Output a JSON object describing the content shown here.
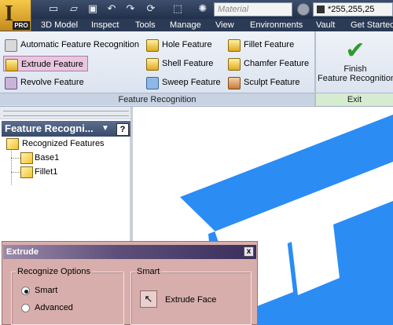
{
  "app": {
    "badge": "PRO"
  },
  "quick_access": {
    "icons": [
      "new-icon",
      "open-icon",
      "save-icon",
      "undo-icon",
      "redo-icon",
      "update-icon",
      "select-icon",
      "appearance-icon"
    ],
    "material_placeholder": "Material",
    "color_value": "*255,255,25"
  },
  "tabs": [
    "3D Model",
    "Inspect",
    "Tools",
    "Manage",
    "View",
    "Environments",
    "Vault",
    "Get Started"
  ],
  "active_tab": "",
  "ribbon": {
    "buttons": [
      {
        "label": "Automatic Feature Recognition",
        "icon": "auto-recognition-icon"
      },
      {
        "label": "Extrude Feature",
        "icon": "extrude-icon"
      },
      {
        "label": "Revolve Feature",
        "icon": "revolve-icon"
      },
      {
        "label": "Hole Feature",
        "icon": "hole-icon"
      },
      {
        "label": "Shell Feature",
        "icon": "shell-icon"
      },
      {
        "label": "Sweep Feature",
        "icon": "sweep-icon"
      },
      {
        "label": "Fillet Feature",
        "icon": "fillet-icon"
      },
      {
        "label": "Chamfer Feature",
        "icon": "chamfer-icon"
      },
      {
        "label": "Sculpt Feature",
        "icon": "sculpt-icon"
      }
    ],
    "panel_label": "Feature Recognition",
    "finish_line1": "Finish",
    "finish_line2": "Feature Recognition",
    "exit_label": "Exit"
  },
  "browser": {
    "title": "Feature Recogni...",
    "help": "?",
    "tree": [
      {
        "label": "Recognized Features"
      },
      {
        "label": "Base1"
      },
      {
        "label": "Fillet1"
      }
    ]
  },
  "dialog": {
    "title": "Extrude",
    "close": "x",
    "recognize_group": "Recognize Options",
    "options": [
      "Smart",
      "Advanced"
    ],
    "selected_option": "Smart",
    "smart_group": "Smart",
    "extrude_face_label": "Extrude Face"
  },
  "colors": {
    "model": "#2b8cf4",
    "dialog_bg": "#d8aeac",
    "ribbon_highlight": "#e8c6df"
  }
}
